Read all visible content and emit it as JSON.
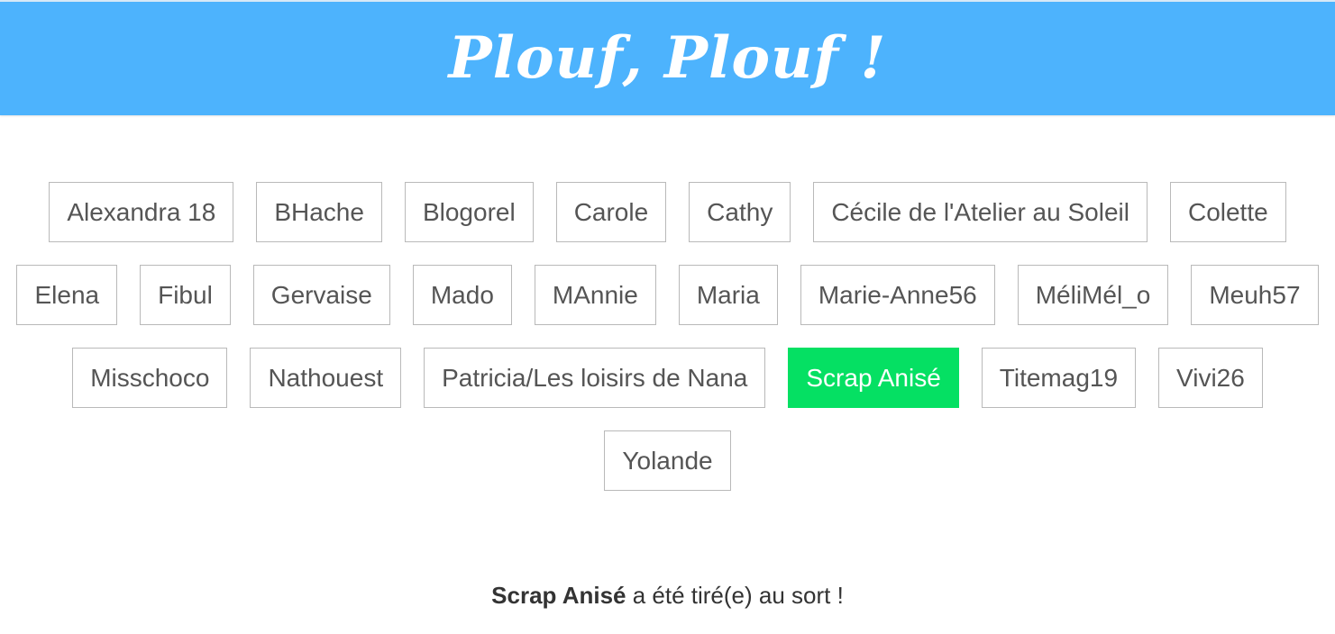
{
  "header": {
    "title": "Plouf, Plouf !"
  },
  "names": [
    "Alexandra 18",
    "BHache",
    "Blogorel",
    "Carole",
    "Cathy",
    "Cécile de l'Atelier au Soleil",
    "Colette",
    "Elena",
    "Fibul",
    "Gervaise",
    "Mado",
    "MAnnie",
    "Maria",
    "Marie-Anne56",
    "MéliMél_o",
    "Meuh57",
    "Misschoco",
    "Nathouest",
    "Patricia/Les loisirs de Nana",
    "Scrap Anisé",
    "Titemag19",
    "Vivi26",
    "Yolande"
  ],
  "selected_name": "Scrap Anisé",
  "result": {
    "winner": "Scrap Anisé",
    "suffix": " a été tiré(e) au sort !"
  },
  "colors": {
    "header_bg": "#4db3fd",
    "selected_bg": "#05e063",
    "button_border": "#b9b9b9",
    "button_text": "#555555"
  }
}
